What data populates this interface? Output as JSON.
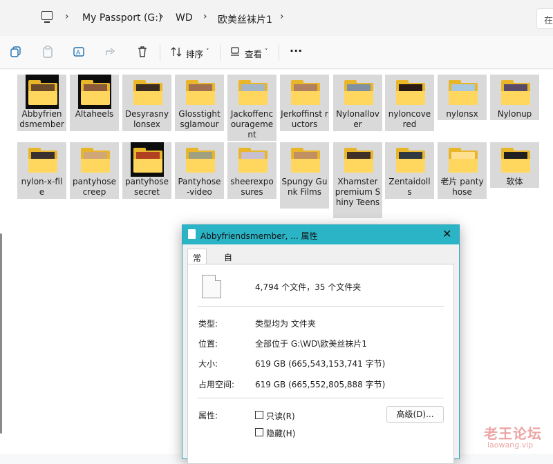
{
  "address_bar": {
    "crumbs": [
      "My Passport (G:)",
      "WD",
      "欧美丝袜片1"
    ],
    "search_placeholder": "在"
  },
  "toolbar": {
    "sort_label": "排序",
    "view_label": "查看",
    "more_label": "···"
  },
  "folders": [
    {
      "name": "Abbyfriendsmember",
      "label": "Abbyfrien dsmember",
      "thumb": "black"
    },
    {
      "name": "Altaheels",
      "label": "Altaheels",
      "thumb": "black"
    },
    {
      "name": "Desyrasnylonsex",
      "label": "Desyrasny lonsex",
      "thumb": "folder"
    },
    {
      "name": "Glosstightsglamour",
      "label": "Glosstight sglamour",
      "thumb": "folder"
    },
    {
      "name": "Jackoffencouragement",
      "label": "Jackoffenc ourageme nt",
      "thumb": "folder"
    },
    {
      "name": "Jerkoffinstructors",
      "label": "Jerkoffinst ructors",
      "thumb": "folder"
    },
    {
      "name": "Nylonallover",
      "label": "Nylonallov er",
      "thumb": "folder"
    },
    {
      "name": "nyloncovered",
      "label": "nyloncove red",
      "thumb": "folder"
    },
    {
      "name": "nylonsx",
      "label": "nylonsx",
      "thumb": "folder"
    },
    {
      "name": "Nylonup",
      "label": "Nylonup",
      "thumb": "folder"
    },
    {
      "name": "nylon-x-file",
      "label": "nylon-x-fil e",
      "thumb": "folder"
    },
    {
      "name": "pantyhosecreep",
      "label": "pantyhose creep",
      "thumb": "folder"
    },
    {
      "name": "pantyhosesecret",
      "label": "pantyhose secret",
      "thumb": "black"
    },
    {
      "name": "Pantyhose-video",
      "label": "Pantyhose -video",
      "thumb": "folder"
    },
    {
      "name": "sheerexposures",
      "label": "sheerexpo sures",
      "thumb": "folder"
    },
    {
      "name": "Spungy Gunk Films",
      "label": "Spungy Gunk Films",
      "thumb": "folder"
    },
    {
      "name": "Xhamster premium Shiny Teens",
      "label": "Xhamster premium Shiny Teens",
      "thumb": "folder"
    },
    {
      "name": "Zentaidolls",
      "label": "Zentaidoll s",
      "thumb": "folder"
    },
    {
      "name": "老片pantyhose",
      "label": "老片 pantyhose",
      "thumb": "folder"
    },
    {
      "name": "软体",
      "label": "软体",
      "thumb": "folder"
    }
  ],
  "dialog": {
    "title": "Abbyfriendsmember, ... 属性",
    "close": "✕",
    "tabs": [
      "常规",
      "自定义"
    ],
    "summary": "4,794 个文件，35 个文件夹",
    "rows": [
      {
        "key": "类型:",
        "value": "类型均为 文件夹"
      },
      {
        "key": "位置:",
        "value": "全部位于 G:\\WD\\欧美丝袜片1"
      },
      {
        "key": "大小:",
        "value": "619 GB (665,543,153,741 字节)"
      },
      {
        "key": "占用空间:",
        "value": "619 GB (665,552,805,888 字节)"
      }
    ],
    "attributes_label": "属性:",
    "readonly_label": "只读(R)",
    "hidden_label": "隐藏(H)",
    "advanced_button": "高级(D)..."
  },
  "watermark": {
    "line1": "老王论坛",
    "line2": "laowang.vip"
  },
  "colors": {
    "accent": "#2bb3c6",
    "folder": "#ffd75e",
    "selection": "#d9d9d9"
  }
}
